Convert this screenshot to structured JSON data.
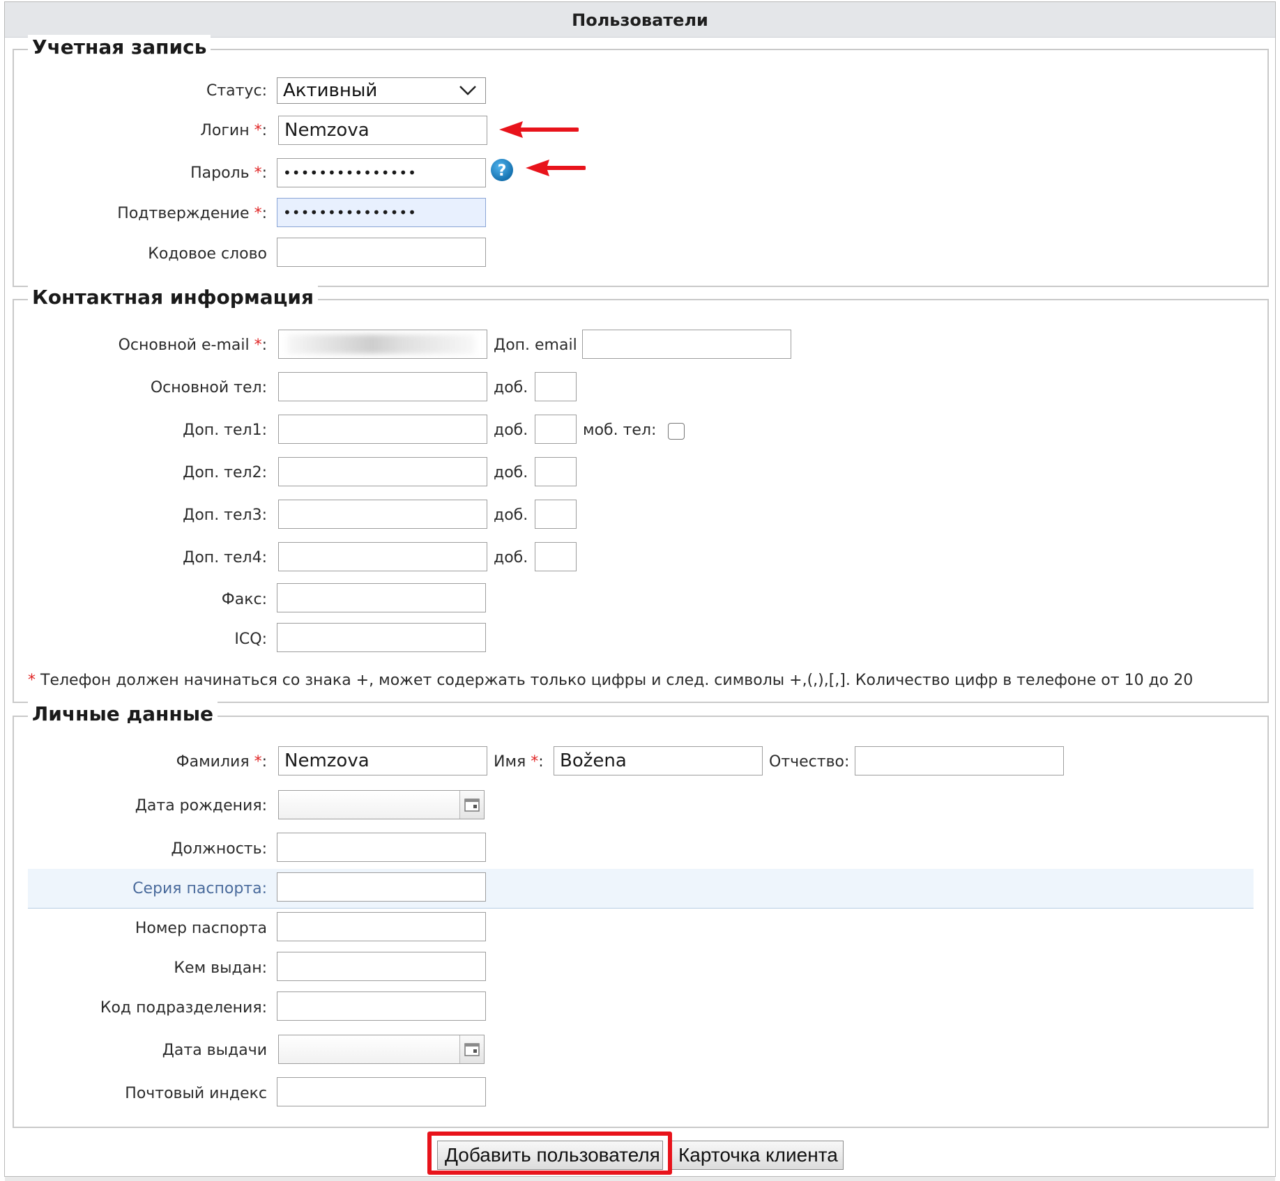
{
  "page_title": "Пользователи",
  "account": {
    "legend": "Учетная запись",
    "status_label": "Статус:",
    "status_value": "Активный",
    "login_label": "Логин",
    "login_value": "Nemzova",
    "password_label": "Пароль",
    "password_value": "•••••••••••••••",
    "confirm_label": "Подтверждение",
    "confirm_value": "•••••••••••••••",
    "codeword_label": "Кодовое слово",
    "required_mark": "*",
    "colon": ":"
  },
  "contact": {
    "legend": "Контактная информация",
    "email_label": "Основной e-mail",
    "extra_email_label": "Доп. email",
    "main_phone_label": "Основной тел:",
    "ext_label": "доб.",
    "phone1_label": "Доп. тел1:",
    "mobile_label": "моб. тел:",
    "phone2_label": "Доп. тел2:",
    "phone3_label": "Доп. тел3:",
    "phone4_label": "Доп. тел4:",
    "fax_label": "Факс:",
    "icq_label": "ICQ:",
    "note": "Телефон должен начинаться со знака +, может содержать только цифры и след. символы +,(,),[,]. Количество цифр в телефоне от 10 до 20"
  },
  "personal": {
    "legend": "Личные данные",
    "lastname_label": "Фамилия",
    "lastname_value": "Nemzova",
    "firstname_label": "Имя",
    "firstname_value": "Božena",
    "middlename_label": "Отчество:",
    "birthdate_label": "Дата рождения:",
    "position_label": "Должность:",
    "passport_series_label": "Серия паспорта:",
    "passport_number_label": "Номер паспорта",
    "issued_by_label": "Кем выдан:",
    "division_code_label": "Код подразделения:",
    "issue_date_label": "Дата выдачи",
    "postal_code_label": "Почтовый индекс"
  },
  "buttons": {
    "add_user": "Добавить пользователя",
    "client_card": "Карточка клиента"
  },
  "colors": {
    "required": "#e02626",
    "annotation_red": "#e8131b",
    "help_icon": "#1b7fc4",
    "header_bg": "#e4e6e9"
  },
  "icons": [
    "chevron-down-icon",
    "help-icon",
    "calendar-icon",
    "annotation-arrow-icon"
  ]
}
